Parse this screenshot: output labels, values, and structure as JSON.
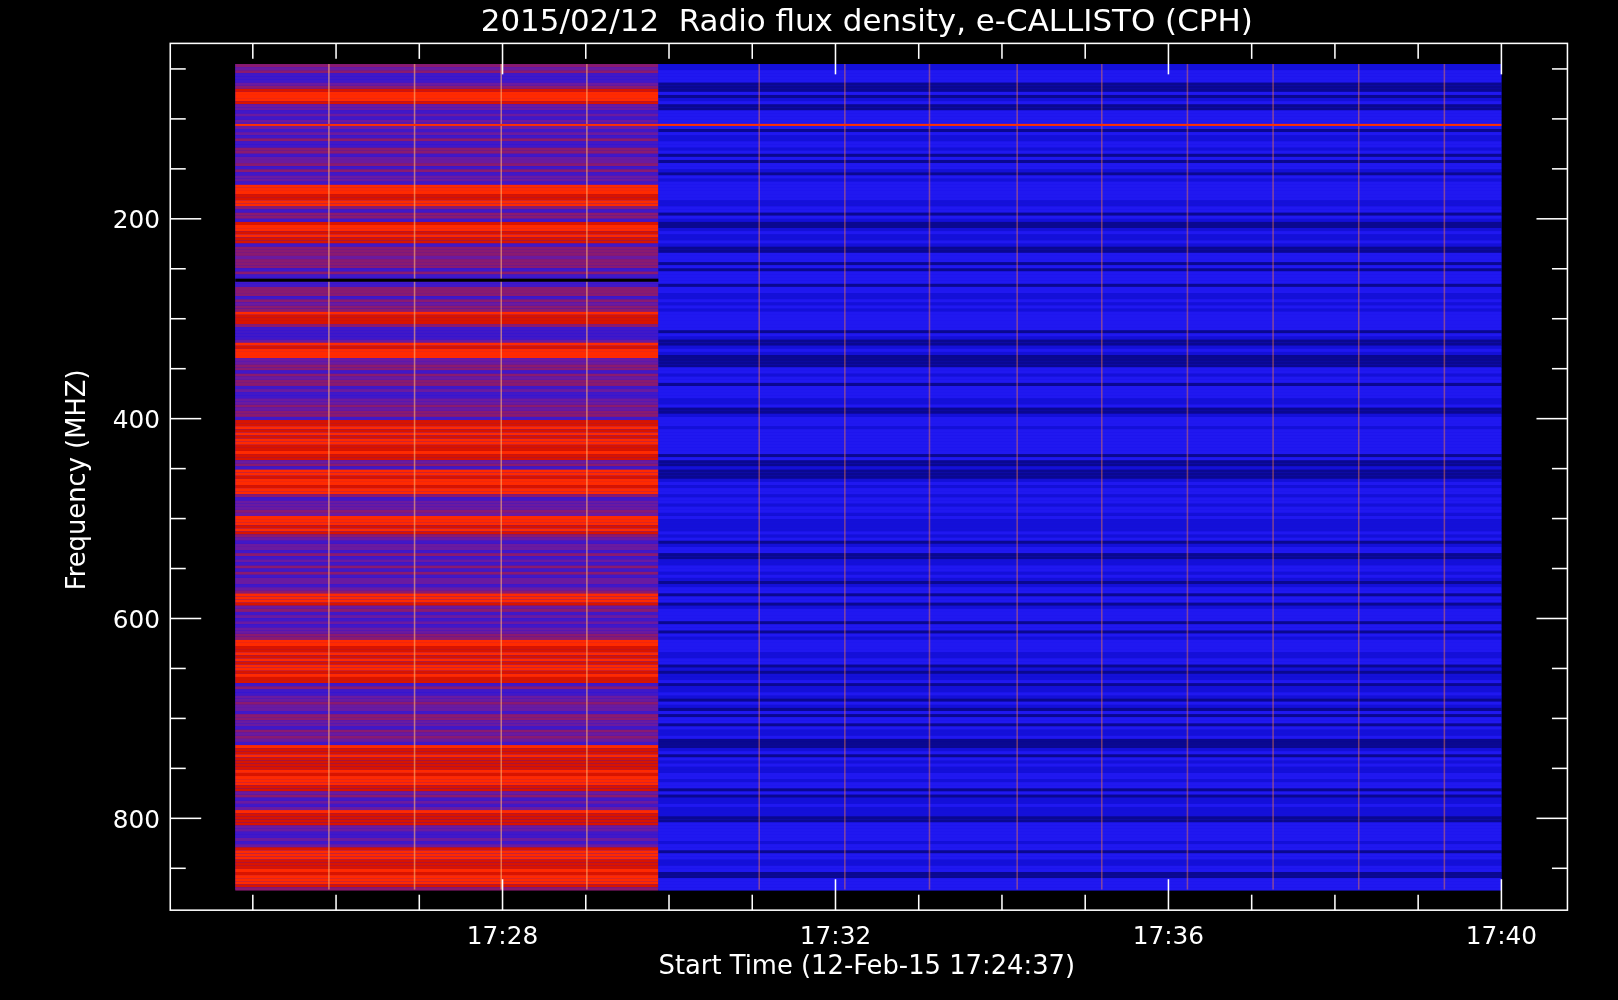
{
  "title": "2015/02/12  Radio flux density, e-CALLISTO (CPH)",
  "y_axis": {
    "label": "Frequency (MHZ)",
    "tick_labels": [
      "200",
      "400",
      "600",
      "800"
    ]
  },
  "x_axis": {
    "label": "Start Time (12-Feb-15 17:24:37)",
    "tick_labels": [
      "17:28",
      "17:32",
      "17:36",
      "17:40"
    ]
  }
}
